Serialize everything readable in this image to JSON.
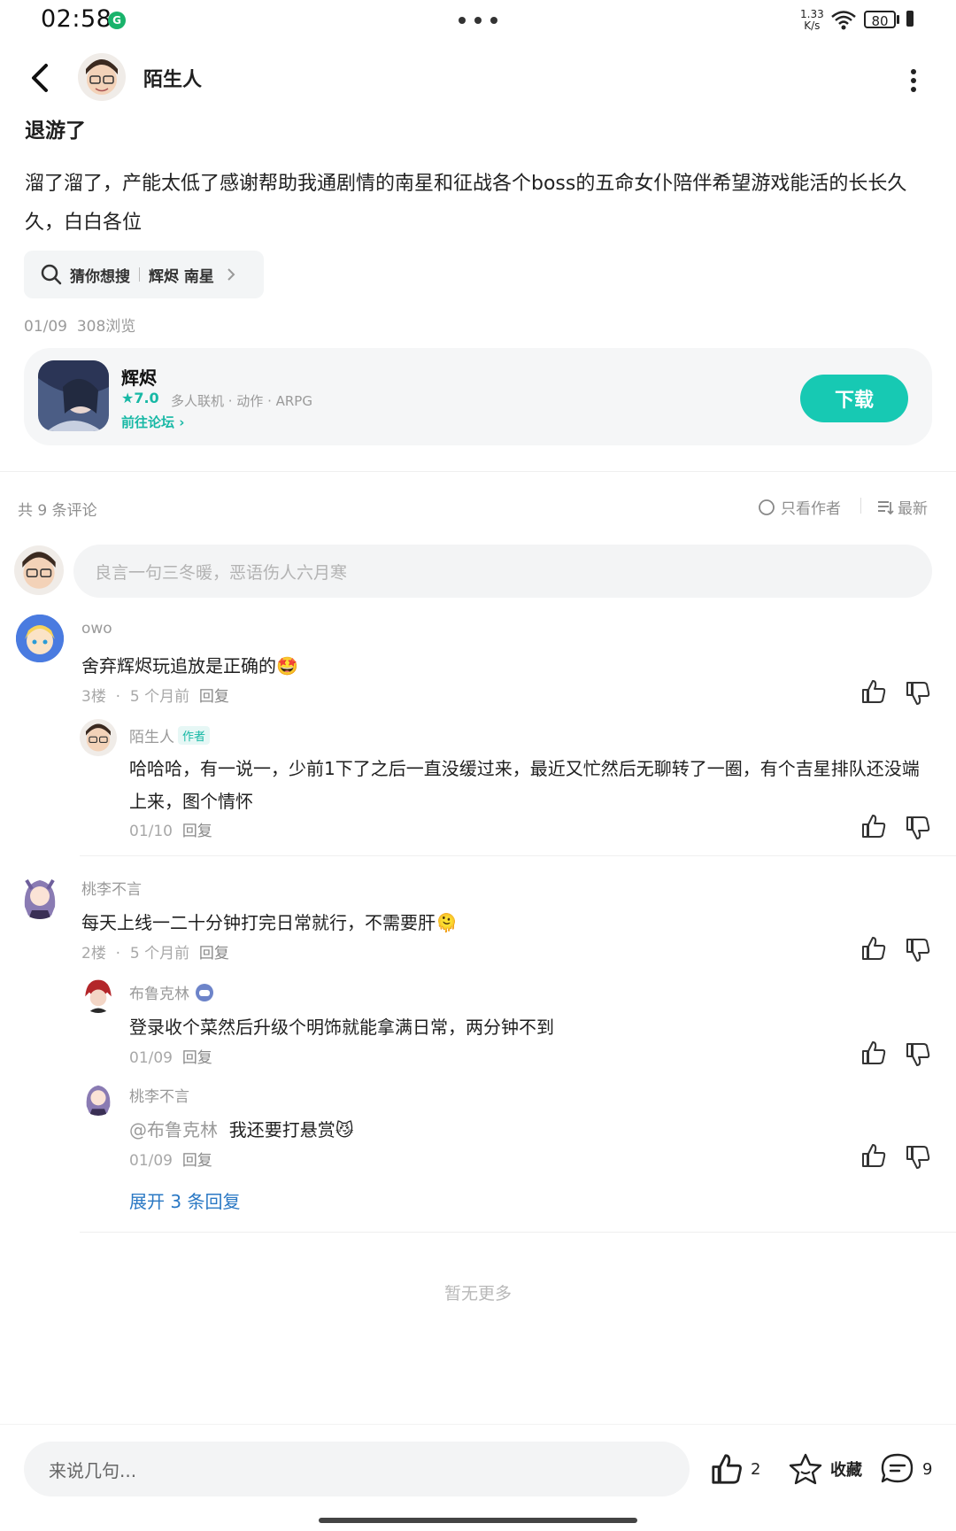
{
  "status": {
    "time": "02:58",
    "net_value": "1.33",
    "net_unit": "K/s",
    "battery": "80"
  },
  "post": {
    "author": "陌生人",
    "title": "退游了",
    "body": "溜了溜了，产能太低了感谢帮助我通剧情的南星和征战各个boss的五命女仆陪伴希望游戏能活的长长久久，白白各位",
    "search_label": "猜你想搜",
    "search_query": "辉烬 南星",
    "date": "01/09",
    "views": "308浏览"
  },
  "game": {
    "name": "辉烬",
    "rating": "★7.0",
    "tags": "多人联机 · 动作 · ARPG",
    "forum_link": "前往论坛",
    "download": "下载"
  },
  "comments_bar": {
    "count": "共 9 条评论",
    "only_author": "只看作者",
    "sort": "最新"
  },
  "input": {
    "placeholder": "良言一句三冬暖，恶语伤人六月寒"
  },
  "comments": [
    {
      "name": "owo",
      "text": "舍弃辉烬玩追放是正确的",
      "emoji": "🤩",
      "floor": "3楼",
      "time": "5 个月前",
      "reply": "回复",
      "replies": [
        {
          "name": "陌生人",
          "tag": "作者",
          "text": "哈哈哈，有一说一，少前1下了之后一直没缓过来，最近又忙然后无聊转了一圈，有个吉星排队还没端上来，图个情怀",
          "time": "01/10",
          "reply": "回复"
        }
      ]
    },
    {
      "name": "桃李不言",
      "text": "每天上线一二十分钟打完日常就行，不需要肝",
      "emoji": "🫠",
      "floor": "2楼",
      "time": "5 个月前",
      "reply": "回复",
      "replies": [
        {
          "name": "布鲁克林",
          "text": "登录收个菜然后升级个明饰就能拿满日常，两分钟不到",
          "time": "01/09",
          "reply": "回复"
        },
        {
          "name": "桃李不言",
          "mention": "@布鲁克林",
          "text": "我还要打悬赏",
          "emoji": "😼",
          "time": "01/09",
          "reply": "回复"
        }
      ],
      "expand": "展开 3 条回复"
    }
  ],
  "no_more": "暂无更多",
  "bottom": {
    "placeholder": "来说几句...",
    "likes": "2",
    "favorite": "收藏",
    "comments": "9"
  },
  "colors": {
    "accent": "#17c9b3",
    "link": "#2a78c4",
    "muted": "#9a9a9a"
  }
}
